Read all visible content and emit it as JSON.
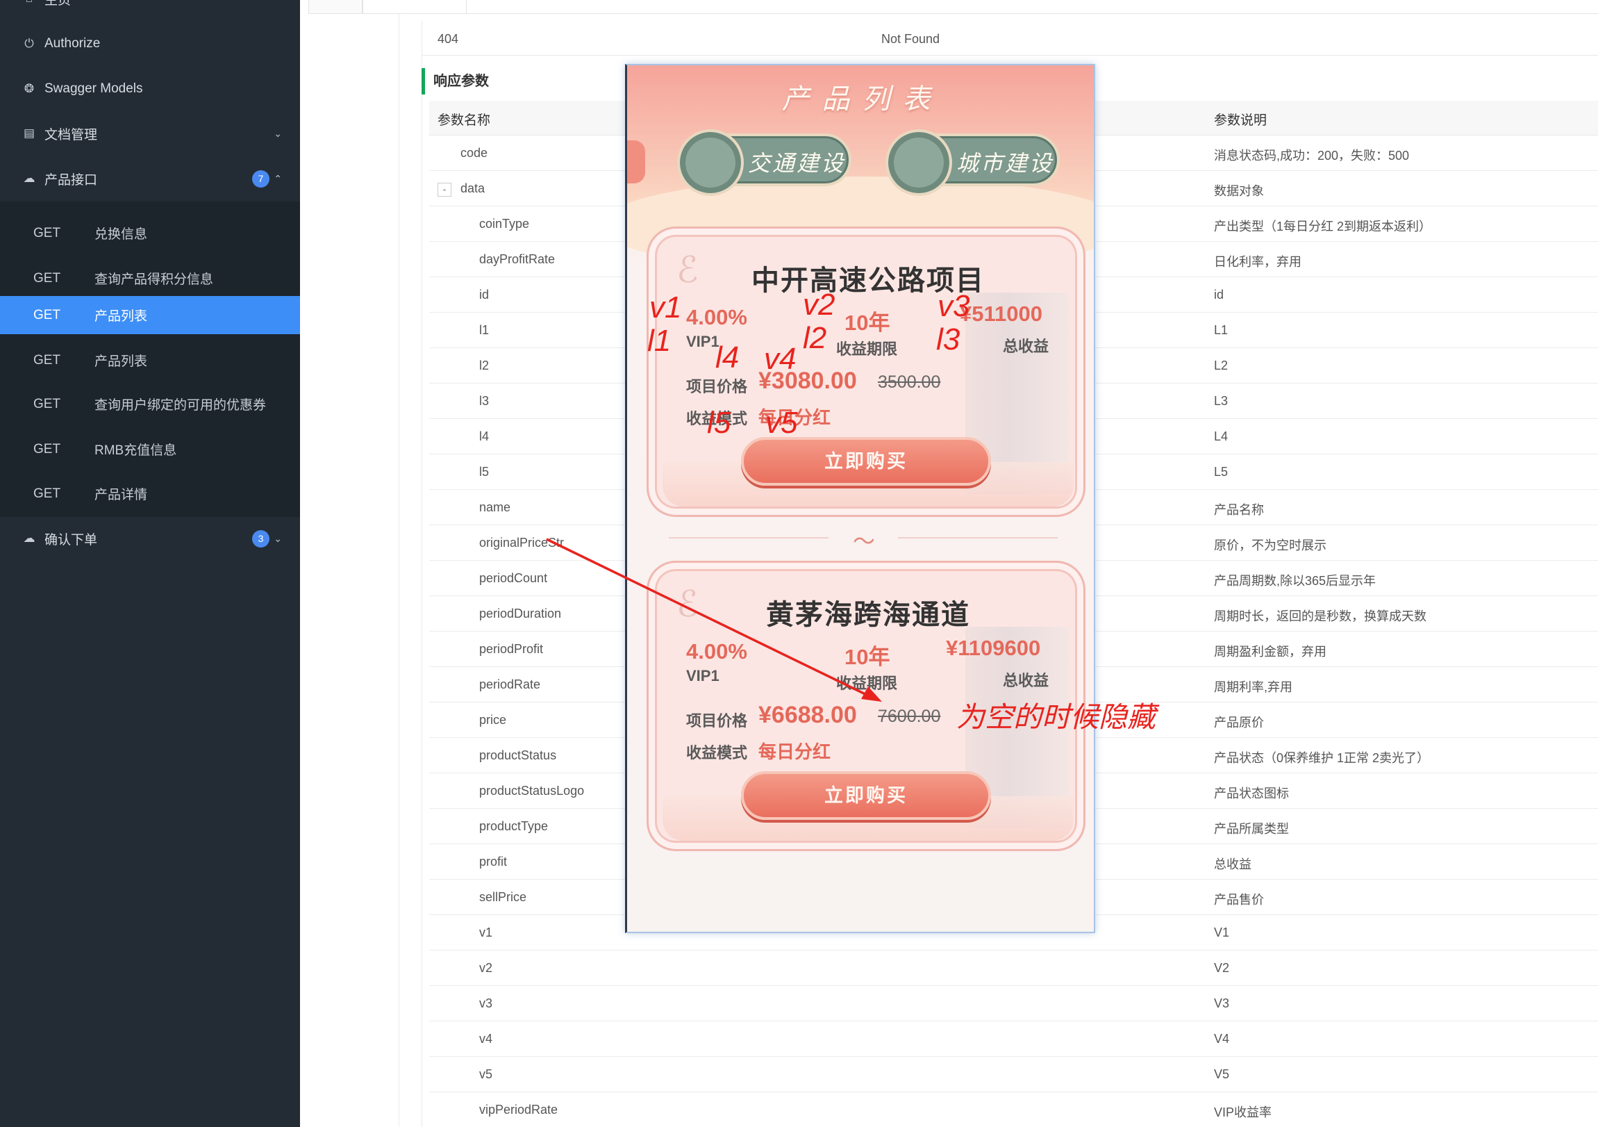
{
  "sidebar": {
    "top_partial": "主页",
    "items": [
      {
        "label": "Authorize",
        "icon": "lock-icon"
      },
      {
        "label": "Swagger Models",
        "icon": "cube-icon"
      },
      {
        "label": "文档管理",
        "icon": "document-icon"
      },
      {
        "label": "产品接口",
        "icon": "cloud-icon",
        "badge": "7"
      },
      {
        "label": "确认下单",
        "icon": "cloud-icon",
        "badge": "3"
      }
    ],
    "submenu": [
      {
        "method": "GET",
        "label": "兑换信息"
      },
      {
        "method": "GET",
        "label": "查询产品得积分信息"
      },
      {
        "method": "GET",
        "label": "产品列表",
        "active": true
      },
      {
        "method": "GET",
        "label": "产品列表"
      },
      {
        "method": "GET",
        "label": "查询用户绑定的可用的优惠券"
      },
      {
        "method": "GET",
        "label": "RMB充值信息"
      },
      {
        "method": "GET",
        "label": "产品详情"
      }
    ]
  },
  "status_row": {
    "code": "404",
    "message": "Not Found"
  },
  "response_params": {
    "title": "响应参数",
    "headers": {
      "name": "参数名称",
      "desc": "参数说明"
    },
    "rows": [
      {
        "name": "code",
        "desc": "消息状态码,成功：200，失败：500"
      },
      {
        "name": "data",
        "desc": "数据对象",
        "toggle": "-"
      },
      {
        "name": "coinType",
        "desc": "产出类型（1每日分红 2到期返本返利）"
      },
      {
        "name": "dayProfitRate",
        "desc": "日化利率，弃用"
      },
      {
        "name": "id",
        "desc": "id"
      },
      {
        "name": "l1",
        "desc": "L1"
      },
      {
        "name": "l2",
        "desc": "L2"
      },
      {
        "name": "l3",
        "desc": "L3"
      },
      {
        "name": "l4",
        "desc": "L4"
      },
      {
        "name": "l5",
        "desc": "L5"
      },
      {
        "name": "name",
        "desc": "产品名称"
      },
      {
        "name": "originalPriceStr",
        "desc": "原价，不为空时展示"
      },
      {
        "name": "periodCount",
        "desc": "产品周期数,除以365后显示年"
      },
      {
        "name": "periodDuration",
        "desc": "周期时长，返回的是秒数，换算成天数"
      },
      {
        "name": "periodProfit",
        "desc": "周期盈利金额，弃用"
      },
      {
        "name": "periodRate",
        "desc": "周期利率,弃用"
      },
      {
        "name": "price",
        "desc": "产品原价"
      },
      {
        "name": "productStatus",
        "desc": "产品状态（0保养维护 1正常 2卖光了）"
      },
      {
        "name": "productStatusLogo",
        "desc": "产品状态图标"
      },
      {
        "name": "productType",
        "desc": "产品所属类型"
      },
      {
        "name": "profit",
        "desc": "总收益"
      },
      {
        "name": "sellPrice",
        "desc": "产品售价"
      },
      {
        "name": "v1",
        "desc": "V1"
      },
      {
        "name": "v2",
        "desc": "V2"
      },
      {
        "name": "v3",
        "desc": "V3"
      },
      {
        "name": "v4",
        "desc": "V4"
      },
      {
        "name": "v5",
        "desc": "V5"
      },
      {
        "name": "vipPeriodRate",
        "desc": "VIP收益率"
      }
    ]
  },
  "overlay": {
    "title": "产品列表",
    "pills": [
      "交通建设",
      "城市建设"
    ],
    "cards": [
      {
        "name": "中开高速公路项目",
        "rate": "4.00%",
        "vip": "VIP1",
        "period": "10年",
        "period_label": "收益期限",
        "profit": "¥511000",
        "profit_label": "总收益",
        "price_label": "项目价格",
        "price": "¥3080.00",
        "original": "3500.00",
        "mode_label": "收益模式",
        "mode": "每日分红",
        "button": "立即购买"
      },
      {
        "name": "黄茅海跨海通道",
        "rate": "4.00%",
        "vip": "VIP1",
        "period": "10年",
        "period_label": "收益期限",
        "profit": "¥1109600",
        "profit_label": "总收益",
        "price_label": "项目价格",
        "price": "¥6688.00",
        "original": "7600.00",
        "mode_label": "收益模式",
        "mode": "每日分红",
        "button": "立即购买"
      }
    ],
    "separator": "～"
  },
  "annotations": {
    "labels": [
      "v1",
      "v2",
      "v3",
      "l1",
      "l2",
      "l3",
      "l4",
      "v4",
      "l5",
      "v5"
    ],
    "note": "为空的时候隐藏",
    "color": "#e8231e"
  },
  "colors": {
    "sidebar_bg": "#232c35",
    "active_bg": "#3d8ef6",
    "accent_green": "#16a55a",
    "price_red": "#e4685a"
  }
}
